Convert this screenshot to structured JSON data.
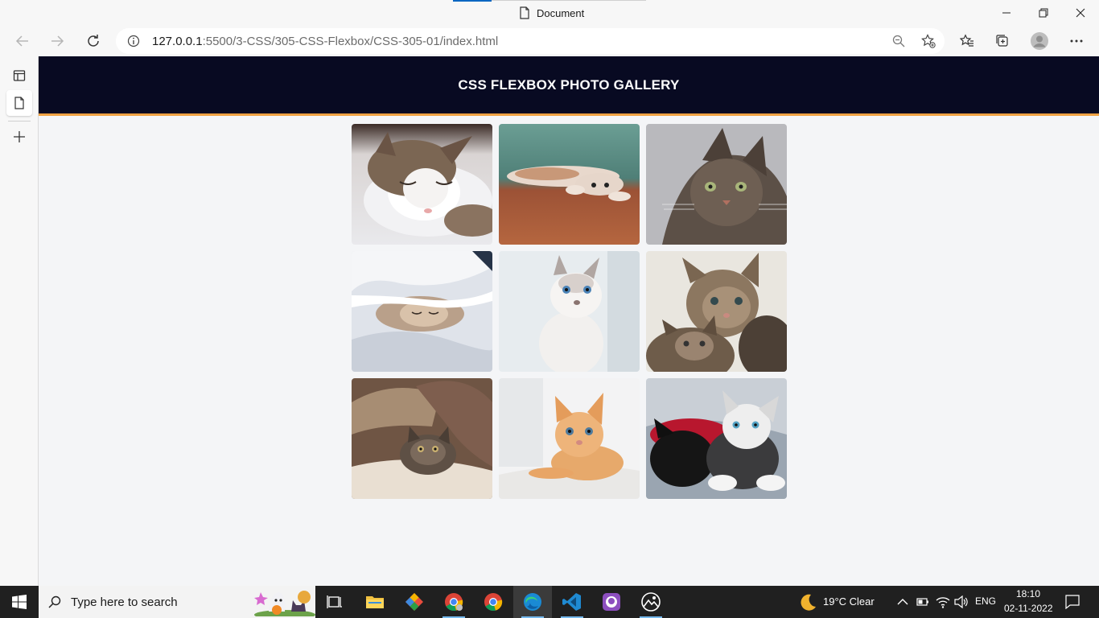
{
  "browser": {
    "tab_title": "Document",
    "url_host": "127.0.0.1",
    "url_rest": ":5500/3-CSS/305-CSS-Flexbox/CSS-305-01/index.html",
    "icons": [
      "back-icon",
      "forward-icon",
      "refresh-icon",
      "site-info-icon",
      "zoom-out-icon",
      "add-favorite-icon",
      "favorites-icon",
      "collections-icon",
      "profile-icon",
      "more-icon"
    ]
  },
  "sidebar": {
    "items": [
      "tab-actions-icon",
      "page-tab-icon",
      "new-tab-icon"
    ]
  },
  "page": {
    "title": "CSS FLEXBOX PHOTO GALLERY",
    "header_bg": "#080a22",
    "header_accent": "#f0a243",
    "photos": [
      {
        "subject": "sleeping tabby-and-white cat on blanket"
      },
      {
        "subject": "cat stretching on wooden floor"
      },
      {
        "subject": "tabby cat portrait"
      },
      {
        "subject": "kitten under white duvet"
      },
      {
        "subject": "white kitten with blue eyes"
      },
      {
        "subject": "two tabby kittens"
      },
      {
        "subject": "tabby cat under knit blanket"
      },
      {
        "subject": "orange kitten lying down"
      },
      {
        "subject": "black and white kittens on red blanket"
      }
    ]
  },
  "taskbar": {
    "search_placeholder": "Type here to search",
    "weather": "19°C  Clear",
    "language": "ENG",
    "time": "18:10",
    "date": "02-11-2022"
  }
}
